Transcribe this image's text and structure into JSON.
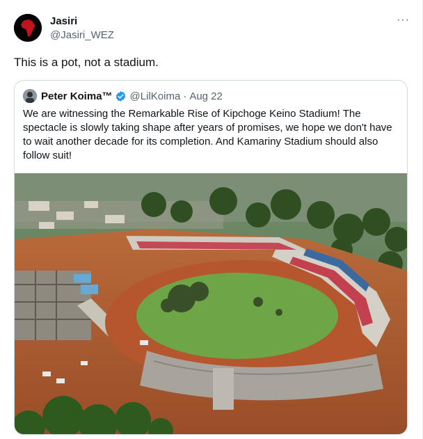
{
  "author": {
    "name": "Jasiri",
    "handle": "@Jasiri_WEZ"
  },
  "more_icon": "more-horizontal-icon",
  "tweet_text": "This is a pot, not a stadium.",
  "quote": {
    "name": "Peter Koima™",
    "handle": "@LilKoima",
    "separator": "·",
    "date": "Aug 22",
    "verified_color": "#1d9bf0",
    "text": "We are witnessing the Remarkable Rise of Kipchoge Keino Stadium! The spectacle is slowly taking shape after years of promises, we hope we don't have to wait another decade for its completion. And Kamariny Stadium should also follow suit!"
  }
}
